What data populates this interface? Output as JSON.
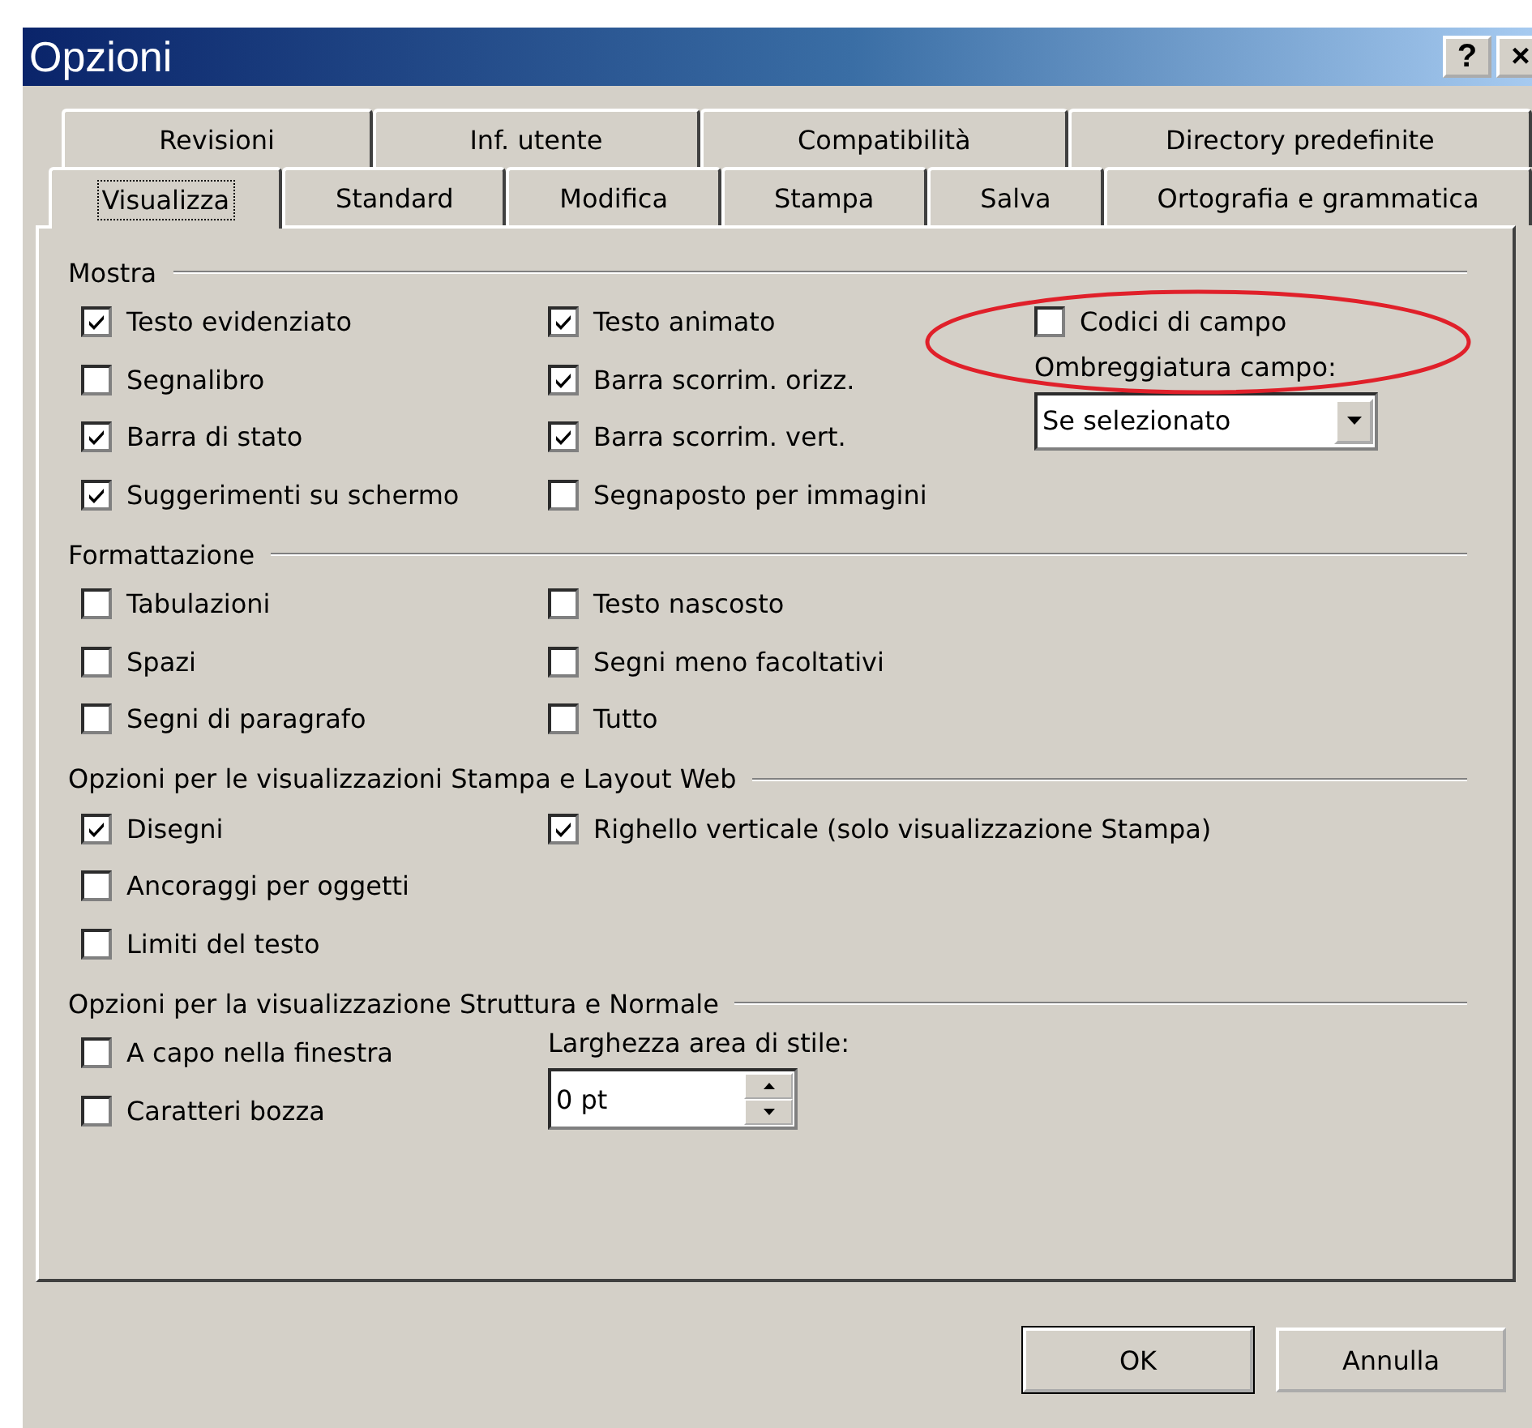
{
  "window": {
    "title": "Opzioni",
    "buttons": [
      "?",
      "×"
    ]
  },
  "tab_rows": [
    [
      {
        "label": "Revisioni",
        "selected": false
      },
      {
        "label": "Inf. utente",
        "selected": false
      },
      {
        "label": "Compatibilità",
        "selected": false
      },
      {
        "label": "Directory predefinite",
        "selected": false
      }
    ],
    [
      {
        "label": "Visualizza",
        "selected": true
      },
      {
        "label": "Standard",
        "selected": false
      },
      {
        "label": "Modifica",
        "selected": false
      },
      {
        "label": "Stampa",
        "selected": false
      },
      {
        "label": "Salva",
        "selected": false
      },
      {
        "label": "Ortografia e grammatica",
        "selected": false
      }
    ]
  ],
  "groups": [
    {
      "title": "Mostra",
      "columns": [
        [
          {
            "kind": "checkbox",
            "label": "Testo evidenziato",
            "checked": true
          },
          {
            "kind": "checkbox",
            "label": "Segnalibro",
            "checked": false
          },
          {
            "kind": "checkbox",
            "label": "Barra di stato",
            "checked": true
          },
          {
            "kind": "checkbox",
            "label": "Suggerimenti su schermo",
            "checked": true
          }
        ],
        [
          {
            "kind": "checkbox",
            "label": "Testo animato",
            "checked": true
          },
          {
            "kind": "checkbox",
            "label": "Barra scorrim. orizz.",
            "checked": true
          },
          {
            "kind": "checkbox",
            "label": "Barra scorrim. vert.",
            "checked": true
          },
          {
            "kind": "checkbox",
            "label": "Segnaposto per immagini",
            "checked": false
          }
        ],
        [
          {
            "kind": "checkbox",
            "label": "Codici di campo",
            "checked": false
          },
          {
            "kind": "dropdown",
            "label": "Ombreggiatura campo:",
            "value": "Se selezionato"
          }
        ]
      ]
    },
    {
      "title": "Formattazione",
      "columns": [
        [
          {
            "kind": "checkbox",
            "label": "Tabulazioni",
            "checked": false
          },
          {
            "kind": "checkbox",
            "label": "Spazi",
            "checked": false
          },
          {
            "kind": "checkbox",
            "label": "Segni di paragrafo",
            "checked": false
          }
        ],
        [
          {
            "kind": "checkbox",
            "label": "Testo nascosto",
            "checked": false
          },
          {
            "kind": "checkbox",
            "label": "Segni meno facoltativi",
            "checked": false
          },
          {
            "kind": "checkbox",
            "label": "Tutto",
            "checked": false
          }
        ]
      ]
    },
    {
      "title": "Opzioni per le visualizzazioni Stampa e Layout Web",
      "columns": [
        [
          {
            "kind": "checkbox",
            "label": "Disegni",
            "checked": true
          },
          {
            "kind": "checkbox",
            "label": "Ancoraggi per oggetti",
            "checked": false
          },
          {
            "kind": "checkbox",
            "label": "Limiti del testo",
            "checked": false
          }
        ],
        [
          {
            "kind": "checkbox",
            "label": "Righello verticale (solo visualizzazione Stampa)",
            "checked": true
          }
        ]
      ]
    },
    {
      "title": "Opzioni per la visualizzazione Struttura e Normale",
      "columns": [
        [
          {
            "kind": "checkbox",
            "label": "A capo nella finestra",
            "checked": false
          },
          {
            "kind": "checkbox",
            "label": "Caratteri bozza",
            "checked": false
          }
        ],
        [
          {
            "kind": "spinner",
            "label": "Larghezza area di stile:",
            "value": "0 pt"
          }
        ]
      ]
    }
  ],
  "buttons": [
    {
      "label": "OK",
      "default": true
    },
    {
      "label": "Annulla",
      "default": false
    }
  ]
}
